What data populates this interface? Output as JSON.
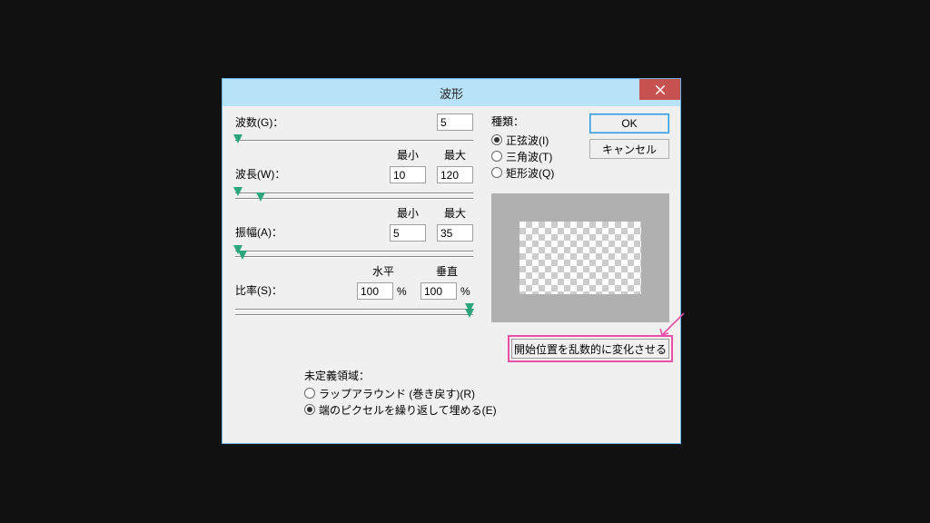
{
  "dialog": {
    "title": "波形",
    "close": "×"
  },
  "labels": {
    "generators": "波数(G)：",
    "wavelength": "波長(W)：",
    "amplitude": "振幅(A)：",
    "scale": "比率(S)：",
    "min": "最小",
    "max": "最大",
    "horiz": "水平",
    "vert": "垂直",
    "percent": "%"
  },
  "values": {
    "generators": "5",
    "wavelength_min": "10",
    "wavelength_max": "120",
    "amplitude_min": "5",
    "amplitude_max": "35",
    "scale_h": "100",
    "scale_v": "100"
  },
  "type_group": {
    "label": "種類：",
    "options": [
      {
        "label": "正弦波(I)",
        "checked": true
      },
      {
        "label": "三角波(T)",
        "checked": false
      },
      {
        "label": "矩形波(Q)",
        "checked": false
      }
    ]
  },
  "buttons": {
    "ok": "OK",
    "cancel": "キャンセル",
    "randomize": "開始位置を乱数的に変化させる"
  },
  "undef": {
    "label": "未定義領域：",
    "options": [
      {
        "label": "ラップアラウンド (巻き戻す)(R)",
        "checked": false
      },
      {
        "label": "端のピクセルを繰り返して埋める(E)",
        "checked": true
      }
    ]
  },
  "annotation": {
    "color": "#e94fa7"
  }
}
